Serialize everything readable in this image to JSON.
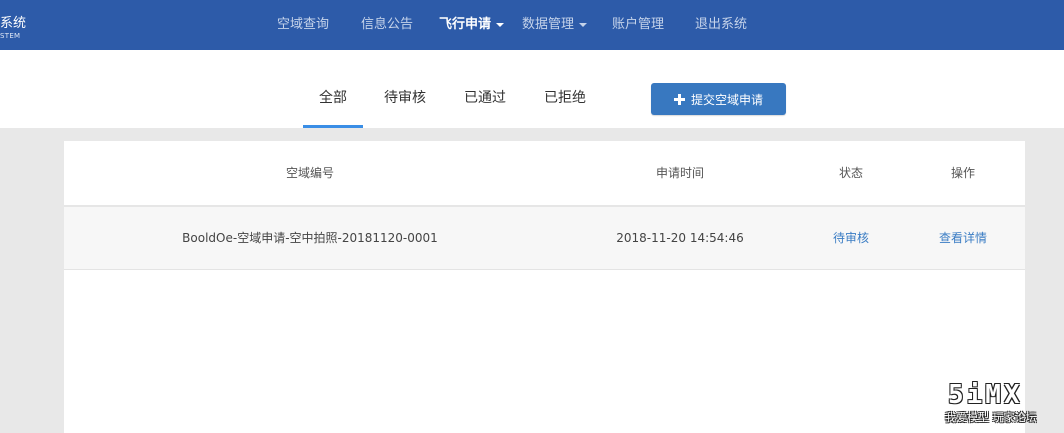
{
  "brand": {
    "title": "系统",
    "subtitle": "STEM"
  },
  "nav": {
    "items": [
      {
        "label": "空域查询"
      },
      {
        "label": "信息公告"
      },
      {
        "label": "飞行申请"
      },
      {
        "label": "数据管理"
      },
      {
        "label": "账户管理"
      },
      {
        "label": "退出系统"
      }
    ],
    "active": "飞行申请"
  },
  "tabs": {
    "items": [
      {
        "label": "全部"
      },
      {
        "label": "待审核"
      },
      {
        "label": "已通过"
      },
      {
        "label": "已拒绝"
      }
    ],
    "active": "全部"
  },
  "submit_button": {
    "label": "提交空域申请",
    "icon": "plus-icon"
  },
  "table": {
    "columns": [
      "空域编号",
      "申请时间",
      "状态",
      "操作"
    ],
    "rows": [
      {
        "id": "BooldOe-空域申请-空中拍照-20181120-0001",
        "time": "2018-11-20 14:54:46",
        "status": "待审核",
        "action": "查看详情"
      }
    ]
  },
  "watermark": {
    "logo": "5iMX",
    "text": "我爱模型 玩家论坛"
  },
  "colors": {
    "navbar": "#2d5ba9",
    "accent": "#3a8ee6",
    "button": "#3878c0",
    "link": "#3b7dc4"
  }
}
